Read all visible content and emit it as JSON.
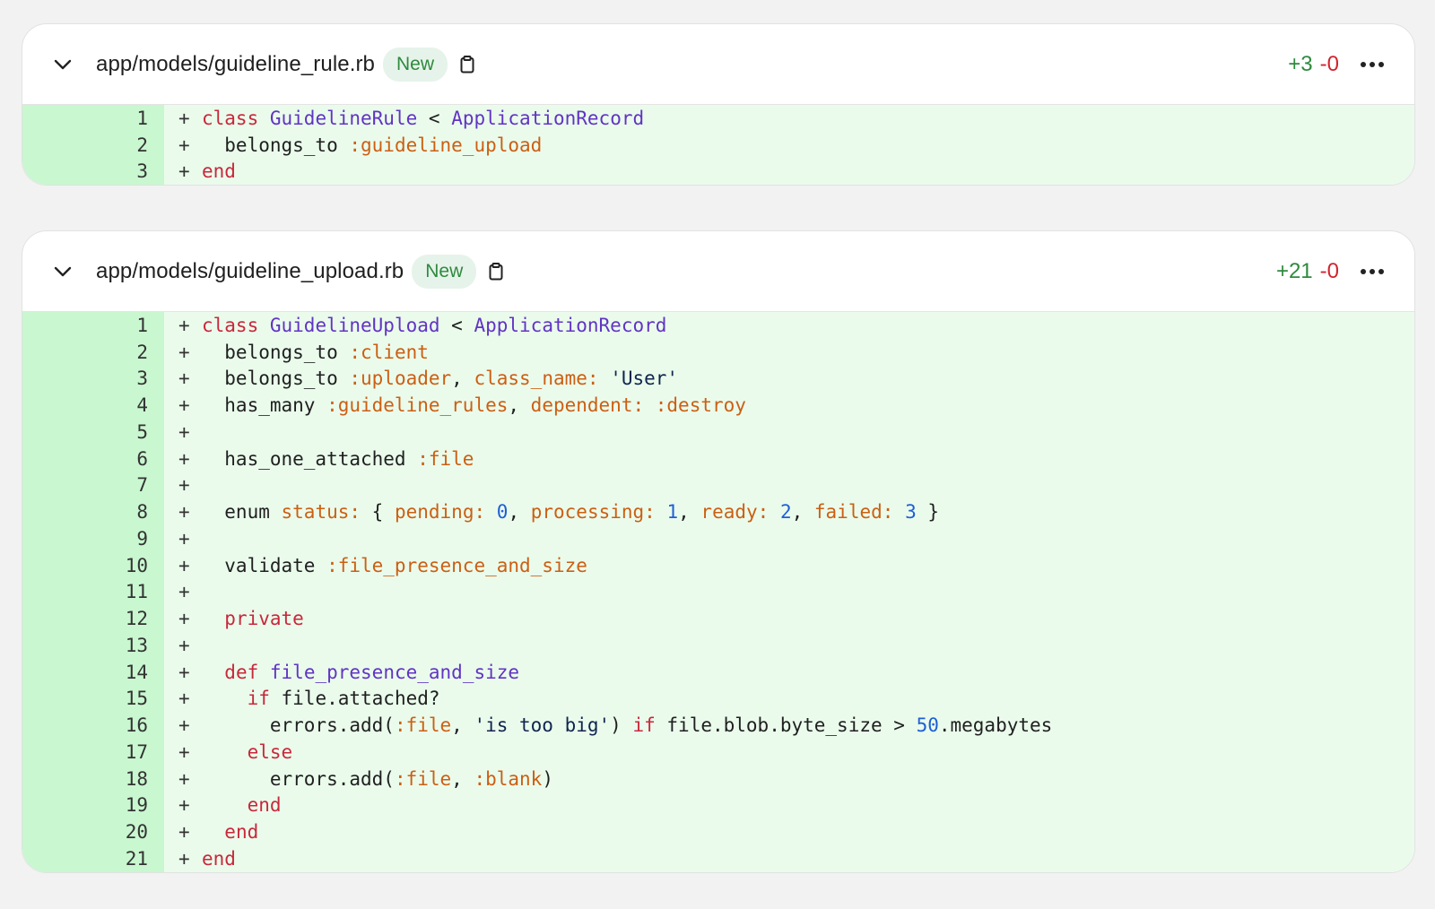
{
  "files": [
    {
      "path": "app/models/guideline_rule.rb",
      "badge": "New",
      "additions": "+3",
      "deletions": "-0",
      "lines": [
        {
          "n": "1",
          "sign": "+",
          "tokens": [
            [
              "kw",
              "class"
            ],
            [
              "p",
              " "
            ],
            [
              "cls",
              "GuidelineRule"
            ],
            [
              "p",
              " < "
            ],
            [
              "cls",
              "ApplicationRecord"
            ]
          ]
        },
        {
          "n": "2",
          "sign": "+",
          "tokens": [
            [
              "p",
              "  belongs_to "
            ],
            [
              "sym",
              ":guideline_upload"
            ]
          ]
        },
        {
          "n": "3",
          "sign": "+",
          "tokens": [
            [
              "kw",
              "end"
            ]
          ]
        }
      ]
    },
    {
      "path": "app/models/guideline_upload.rb",
      "badge": "New",
      "additions": "+21",
      "deletions": "-0",
      "lines": [
        {
          "n": "1",
          "sign": "+",
          "tokens": [
            [
              "kw",
              "class"
            ],
            [
              "p",
              " "
            ],
            [
              "cls",
              "GuidelineUpload"
            ],
            [
              "p",
              " < "
            ],
            [
              "cls",
              "ApplicationRecord"
            ]
          ]
        },
        {
          "n": "2",
          "sign": "+",
          "tokens": [
            [
              "p",
              "  belongs_to "
            ],
            [
              "sym",
              ":client"
            ]
          ]
        },
        {
          "n": "3",
          "sign": "+",
          "tokens": [
            [
              "p",
              "  belongs_to "
            ],
            [
              "sym",
              ":uploader"
            ],
            [
              "p",
              ", "
            ],
            [
              "sym",
              "class_name:"
            ],
            [
              "p",
              " "
            ],
            [
              "str",
              "'User'"
            ]
          ]
        },
        {
          "n": "4",
          "sign": "+",
          "tokens": [
            [
              "p",
              "  has_many "
            ],
            [
              "sym",
              ":guideline_rules"
            ],
            [
              "p",
              ", "
            ],
            [
              "sym",
              "dependent:"
            ],
            [
              "p",
              " "
            ],
            [
              "sym",
              ":destroy"
            ]
          ]
        },
        {
          "n": "5",
          "sign": "+",
          "tokens": []
        },
        {
          "n": "6",
          "sign": "+",
          "tokens": [
            [
              "p",
              "  has_one_attached "
            ],
            [
              "sym",
              ":file"
            ]
          ]
        },
        {
          "n": "7",
          "sign": "+",
          "tokens": []
        },
        {
          "n": "8",
          "sign": "+",
          "tokens": [
            [
              "p",
              "  enum "
            ],
            [
              "sym",
              "status:"
            ],
            [
              "p",
              " { "
            ],
            [
              "sym",
              "pending:"
            ],
            [
              "p",
              " "
            ],
            [
              "num",
              "0"
            ],
            [
              "p",
              ", "
            ],
            [
              "sym",
              "processing:"
            ],
            [
              "p",
              " "
            ],
            [
              "num",
              "1"
            ],
            [
              "p",
              ", "
            ],
            [
              "sym",
              "ready:"
            ],
            [
              "p",
              " "
            ],
            [
              "num",
              "2"
            ],
            [
              "p",
              ", "
            ],
            [
              "sym",
              "failed:"
            ],
            [
              "p",
              " "
            ],
            [
              "num",
              "3"
            ],
            [
              "p",
              " }"
            ]
          ]
        },
        {
          "n": "9",
          "sign": "+",
          "tokens": []
        },
        {
          "n": "10",
          "sign": "+",
          "tokens": [
            [
              "p",
              "  validate "
            ],
            [
              "sym",
              ":file_presence_and_size"
            ]
          ]
        },
        {
          "n": "11",
          "sign": "+",
          "tokens": []
        },
        {
          "n": "12",
          "sign": "+",
          "tokens": [
            [
              "p",
              "  "
            ],
            [
              "kw",
              "private"
            ]
          ]
        },
        {
          "n": "13",
          "sign": "+",
          "tokens": []
        },
        {
          "n": "14",
          "sign": "+",
          "tokens": [
            [
              "p",
              "  "
            ],
            [
              "kw",
              "def"
            ],
            [
              "p",
              " "
            ],
            [
              "cls",
              "file_presence_and_size"
            ]
          ]
        },
        {
          "n": "15",
          "sign": "+",
          "tokens": [
            [
              "p",
              "    "
            ],
            [
              "kw",
              "if"
            ],
            [
              "p",
              " file.attached?"
            ]
          ]
        },
        {
          "n": "16",
          "sign": "+",
          "tokens": [
            [
              "p",
              "      errors.add("
            ],
            [
              "sym",
              ":file"
            ],
            [
              "p",
              ", "
            ],
            [
              "str",
              "'is too big'"
            ],
            [
              "p",
              ") "
            ],
            [
              "kw",
              "if"
            ],
            [
              "p",
              " file.blob.byte_size > "
            ],
            [
              "num",
              "50"
            ],
            [
              "p",
              ".megabytes"
            ]
          ]
        },
        {
          "n": "17",
          "sign": "+",
          "tokens": [
            [
              "p",
              "    "
            ],
            [
              "kw",
              "else"
            ]
          ]
        },
        {
          "n": "18",
          "sign": "+",
          "tokens": [
            [
              "p",
              "      errors.add("
            ],
            [
              "sym",
              ":file"
            ],
            [
              "p",
              ", "
            ],
            [
              "sym",
              ":blank"
            ],
            [
              "p",
              ")"
            ]
          ]
        },
        {
          "n": "19",
          "sign": "+",
          "tokens": [
            [
              "p",
              "    "
            ],
            [
              "kw",
              "end"
            ]
          ]
        },
        {
          "n": "20",
          "sign": "+",
          "tokens": [
            [
              "p",
              "  "
            ],
            [
              "kw",
              "end"
            ]
          ]
        },
        {
          "n": "21",
          "sign": "+",
          "tokens": [
            [
              "kw",
              "end"
            ]
          ]
        }
      ]
    }
  ],
  "colors": {
    "addition_bg": "#eafbec",
    "gutter_bg": "#c9f7d0",
    "badge_bg": "#e6f3ea",
    "badge_text": "#2e8a3e",
    "additions": "#2e8a3e",
    "deletions": "#d1242f"
  },
  "icons": {
    "collapse": "chevron-down-icon",
    "copy": "clipboard-icon",
    "more": "ellipsis-icon"
  }
}
